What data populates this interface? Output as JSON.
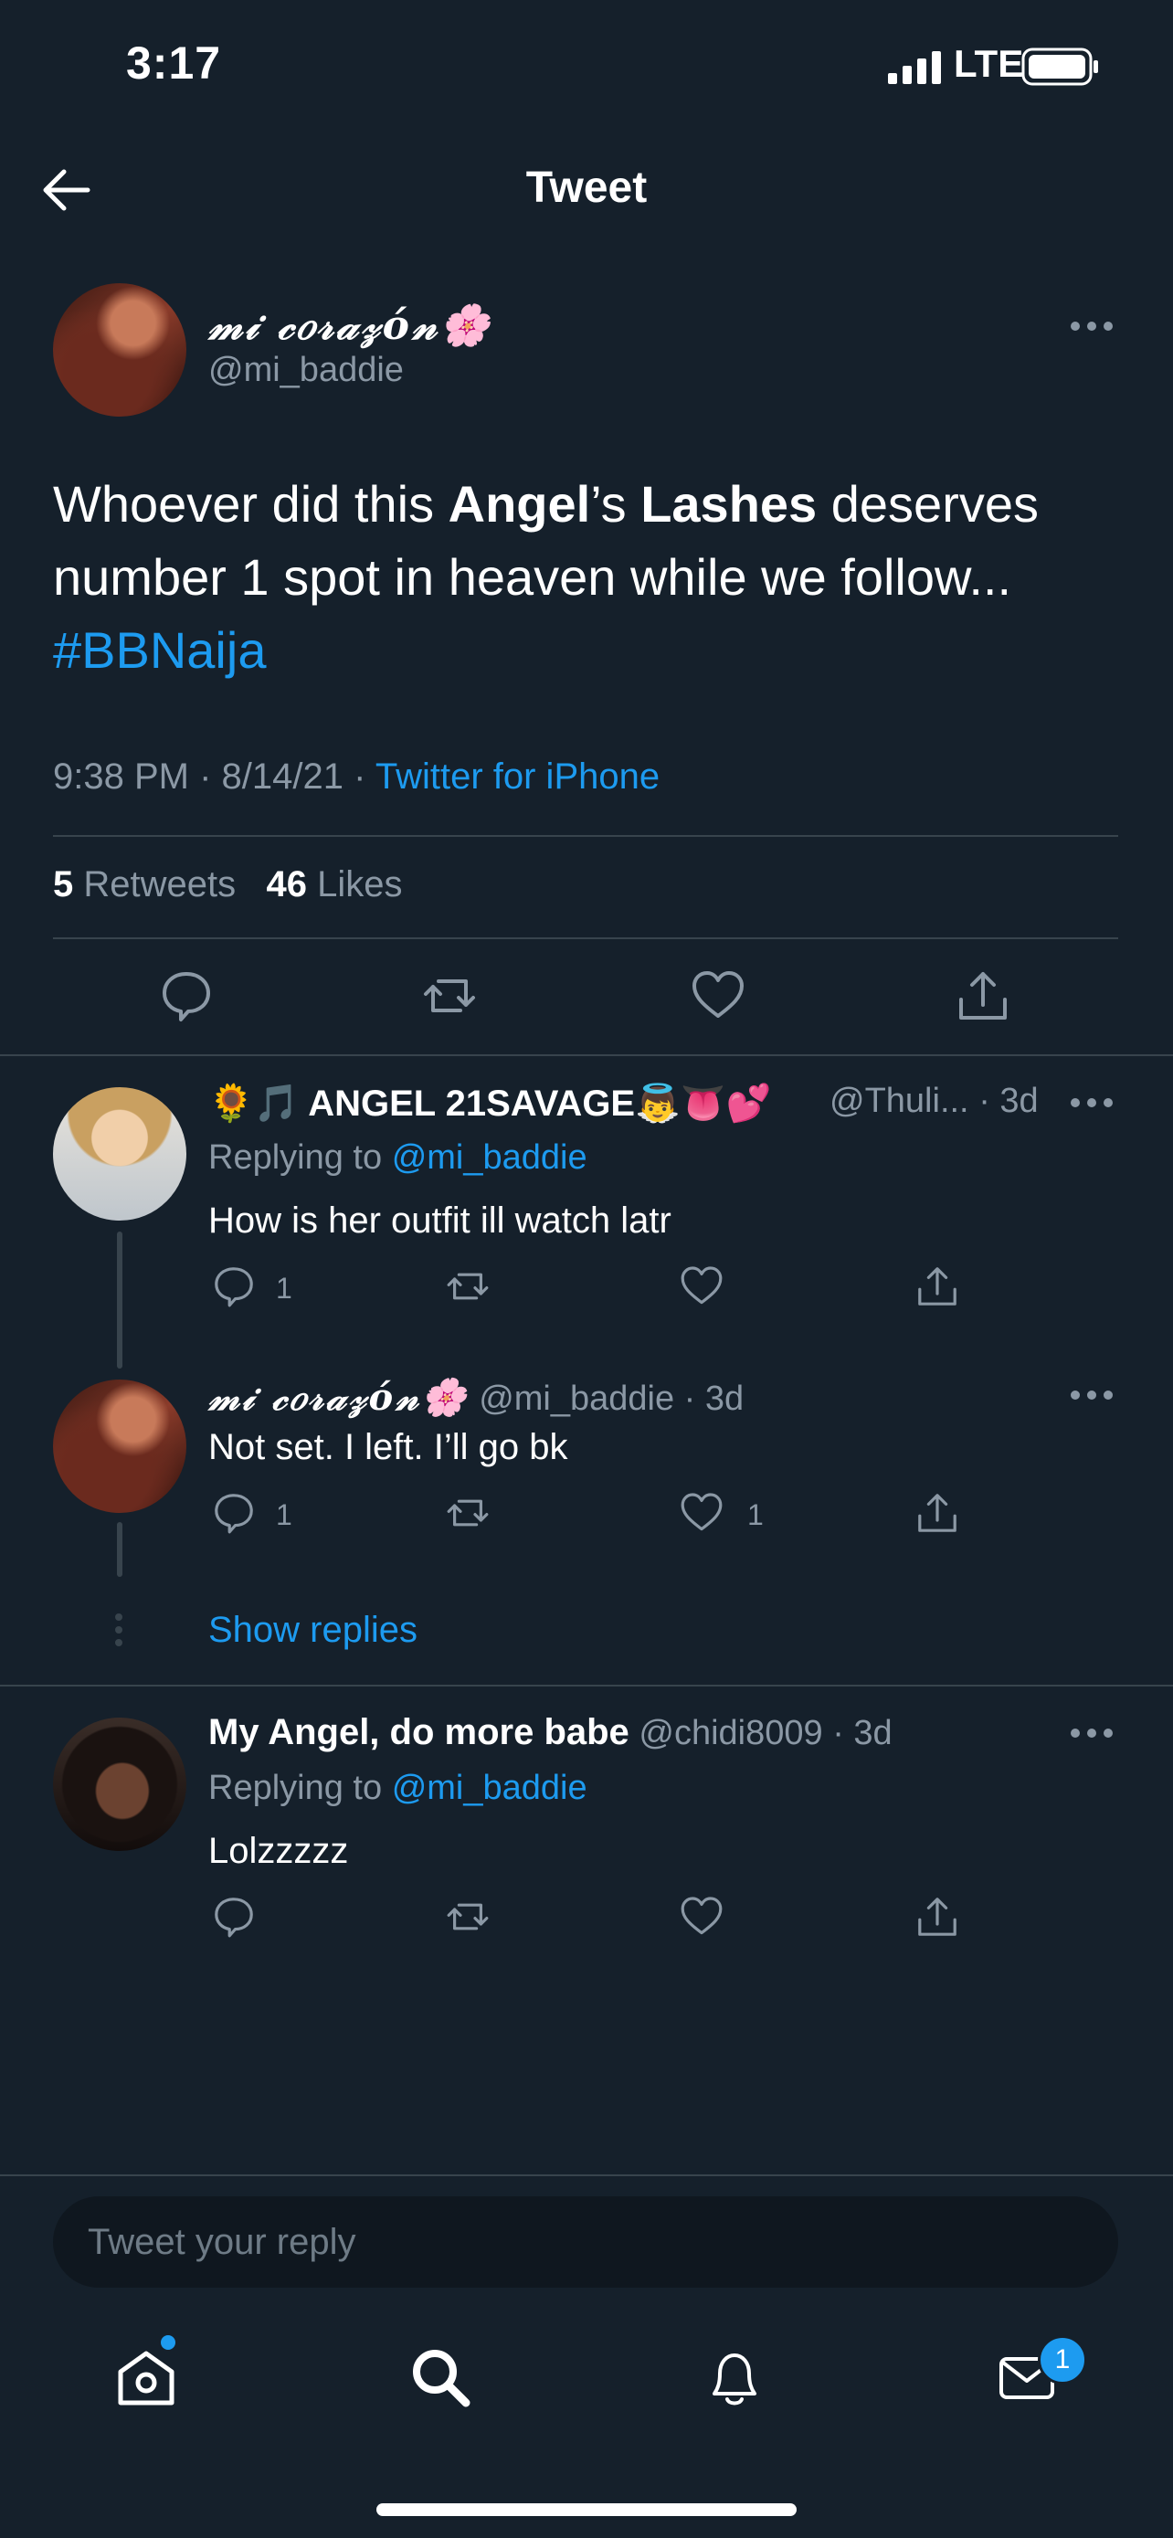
{
  "status_bar": {
    "time": "3:17",
    "network": "LTE"
  },
  "nav": {
    "title": "Tweet"
  },
  "main_tweet": {
    "author_name": "𝓂𝒾 𝒸𝑜𝓇𝒶𝓏ó𝓃🌸",
    "handle": "@mi_baddie",
    "text_parts": {
      "p1": "Whoever did this ",
      "b1": "Angel",
      "p2": "’s ",
      "b2": "Lashes",
      "p3": " deserves number 1 spot in heaven while we follow...",
      "hashtag": "#BBNaija"
    },
    "time": "9:38 PM",
    "date": "8/14/21",
    "separator": "·",
    "source": "Twitter for iPhone",
    "retweets_count": "5",
    "retweets_label": "Retweets",
    "likes_count": "46",
    "likes_label": "Likes"
  },
  "replies": [
    {
      "name": "🌻🎵 ANGEL 21SAVAGE👼👅💕",
      "handle": "@Thuli...",
      "age": "· 3d",
      "replying_label": "Replying to",
      "replying_to": "@mi_baddie",
      "text": "How is her outfit ill watch latr",
      "reply_count": "1",
      "like_count": ""
    },
    {
      "name": "𝓂𝒾 𝒸𝑜𝓇𝒶𝓏ó𝓃🌸",
      "handle": "@mi_baddie",
      "age": "· 3d",
      "text": "Not set. I left. I’ll go bk",
      "reply_count": "1",
      "like_count": "1"
    },
    {
      "name": "My Angel, do more babe",
      "handle": "@chidi8009",
      "age": "· 3d",
      "replying_label": "Replying to",
      "replying_to": "@mi_baddie",
      "text": "Lolzzzzz"
    }
  ],
  "show_replies": "Show replies",
  "reply_input": {
    "placeholder": "Tweet your reply"
  },
  "tab_bar": {
    "messages_badge": "1"
  },
  "colors": {
    "background": "#15202b",
    "accent": "#1d9bf0",
    "muted": "#8b98a5",
    "divider": "#38444d"
  }
}
